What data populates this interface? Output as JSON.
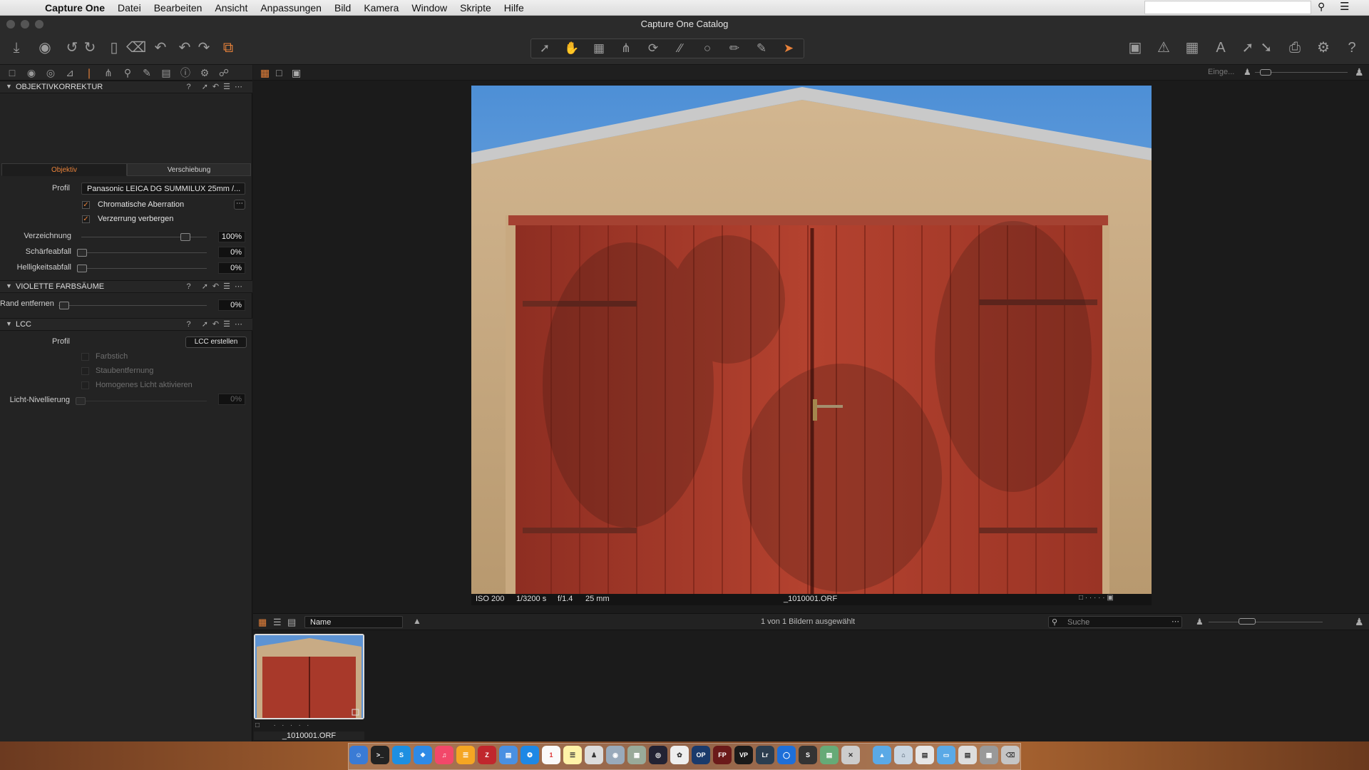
{
  "menubar": {
    "app": "Capture One",
    "items": [
      "Datei",
      "Bearbeiten",
      "Ansicht",
      "Anpassungen",
      "Bild",
      "Kamera",
      "Window",
      "Skripte",
      "Hilfe"
    ]
  },
  "window": {
    "title": "Capture One Catalog"
  },
  "left_panel": {
    "search_hint": "Einge...",
    "lens_correction": {
      "title": "OBJEKTIVKORREKTUR",
      "tabs": [
        "Objektiv",
        "Verschiebung"
      ],
      "active_tab": "Objektiv",
      "profile_label": "Profil",
      "profile_value": "Panasonic LEICA DG SUMMILUX 25mm /...",
      "chromatic_aberration": "Chromatische Aberration",
      "hide_distortion": "Verzerrung verbergen",
      "sliders": [
        {
          "label": "Verzeichnung",
          "value": "100%",
          "level": 1.0
        },
        {
          "label": "Schärfeabfall",
          "value": "0%",
          "level": 0.0
        },
        {
          "label": "Helligkeitsabfall",
          "value": "0%",
          "level": 0.0
        }
      ]
    },
    "purple_fringing": {
      "title": "VIOLETTE FARBSÄUME",
      "slider": {
        "label": "Rand entfernen",
        "value": "0%",
        "level": 0.0
      }
    },
    "lcc": {
      "title": "LCC",
      "profile_label": "Profil",
      "button": "LCC erstellen",
      "options": [
        "Farbstich",
        "Staubentfernung",
        "Homogenes Licht aktivieren"
      ],
      "slider": {
        "label": "Licht-Nivellierung",
        "value": "0%",
        "level": 0.0
      }
    }
  },
  "viewer": {
    "iso": "ISO 200",
    "shutter": "1/3200 s",
    "aperture": "f/1.4",
    "focal": "25 mm",
    "filename": "_1010001.ORF"
  },
  "browser": {
    "sort_by": "Name",
    "status": "1 von 1 Bildern ausgewählt",
    "search_placeholder": "Suche",
    "thumb_name": "_1010001.ORF"
  },
  "colors": {
    "accent": "#e8823a",
    "panel": "#232323",
    "door_red": "#a93a2b"
  }
}
